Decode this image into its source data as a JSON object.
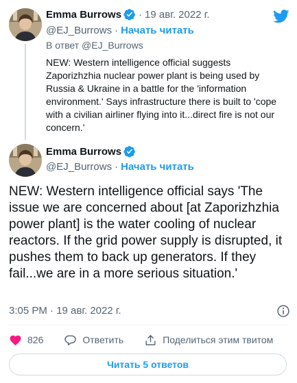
{
  "parent_tweet": {
    "name": "Emma Burrows",
    "date": "19 авг. 2022 г.",
    "handle": "@EJ_Burrows",
    "follow_label": "Начать читать",
    "reply_to_label": "В ответ @EJ_Burrows",
    "text": "NEW: Western intelligence official suggests Zaporizhzhia nuclear power plant is being used by Russia & Ukraine in a battle for the 'information environment.' Says infrastructure there is built to 'cope with a civilian airliner flying into it...direct fire is not our concern.'",
    "separator": "·"
  },
  "main_tweet": {
    "name": "Emma Burrows",
    "handle": "@EJ_Burrows",
    "follow_label": "Начать читать",
    "separator": "·",
    "text": "NEW: Western intelligence official says 'The issue we are concerned about [at Zaporizhzhia power plant] is the water cooling of nuclear reactors. If the grid power supply is disrupted, it pushes them to back up generators. If they fail...we are in a more serious situation.'",
    "timestamp": "3:05 PM · 19 авг. 2022 г.",
    "like_count": "826",
    "reply_label": "Ответить",
    "share_label": "Поделиться этим твитом",
    "read_replies_label": "Читать 5 ответов"
  },
  "colors": {
    "accent": "#1d9bf0",
    "like": "#f91880",
    "secondary_text": "#536471"
  },
  "icons": {
    "brand": "twitter-bird-icon",
    "verified": "verified-badge-icon",
    "info": "info-icon",
    "like": "heart-icon",
    "reply": "reply-bubble-icon",
    "share": "share-upload-icon"
  }
}
